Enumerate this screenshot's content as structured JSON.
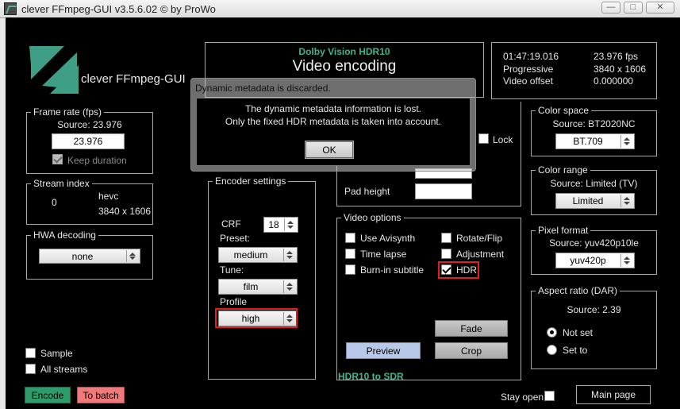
{
  "window": {
    "title": "clever FFmpeg-GUI v3.5.6.02   © by ProWo",
    "minimize": "—",
    "maximize": "□",
    "close": "✕"
  },
  "logo": {
    "text": "clever FFmpeg-GUI",
    "accent": "#3f9f86"
  },
  "header": {
    "format_label": "Dolby Vision HDR10",
    "mode_title": "Video encoding"
  },
  "info": {
    "duration": "01:47:19.016",
    "fps": "23.976 fps",
    "scan": "Progressive",
    "resolution": "3840 x 1606",
    "offset_label": "Video offset",
    "offset_value": "0.000000"
  },
  "frame_rate": {
    "title": "Frame rate (fps)",
    "source": "Source: 23.976",
    "value": "23.976",
    "keep_duration": "Keep duration"
  },
  "stream_index": {
    "title": "Stream index",
    "index": "0",
    "codec": "hevc",
    "resolution": "3840 x 1606"
  },
  "hwa": {
    "title": "HWA decoding",
    "value": "none"
  },
  "encoder": {
    "title": "Encoder settings",
    "crf_label": "CRF",
    "crf_value": "18",
    "preset_label": "Preset:",
    "preset_value": "medium",
    "tune_label": "Tune:",
    "tune_value": "film",
    "profile_label": "Profile",
    "profile_value": "high"
  },
  "crop_pad": {
    "pad_height_label": "Pad height",
    "lock_label": "Lock"
  },
  "video_options": {
    "title": "Video options",
    "use_avisynth": "Use Avisynth",
    "time_lapse": "Time lapse",
    "burn_in": "Burn-in subtitle",
    "rotate_flip": "Rotate/Flip",
    "adjustment": "Adjustment",
    "hdr": "HDR",
    "fade": "Fade",
    "preview": "Preview",
    "crop": "Crop"
  },
  "hdr_note": "HDR10 to SDR",
  "color_space": {
    "title": "Color space",
    "source": "Source: BT2020NC",
    "value": "BT.709"
  },
  "color_range": {
    "title": "Color range",
    "source": "Source: Limited (TV)",
    "value": "Limited"
  },
  "pixel_format": {
    "title": "Pixel format",
    "source": "Source: yuv420p10le",
    "value": "yuv420p"
  },
  "aspect": {
    "title": "Aspect ratio (DAR)",
    "source": "Source: 2.39",
    "not_set": "Not set",
    "set_to": "Set to"
  },
  "bottom": {
    "sample": "Sample",
    "all_streams": "All streams",
    "encode": "Encode",
    "to_batch": "To batch",
    "stay_open": "Stay open",
    "main_page": "Main page"
  },
  "dialog": {
    "title": "Dynamic metadata is discarded.",
    "line1": "The dynamic metadata information is lost.",
    "line2": "Only the fixed HDR metadata is taken into account.",
    "ok": "OK"
  },
  "colors": {
    "encode_bg": "#2e9b6b",
    "batch_bg": "#f07a7a",
    "preview_bg": "#b8c8e8",
    "highlight": "#e02020"
  }
}
